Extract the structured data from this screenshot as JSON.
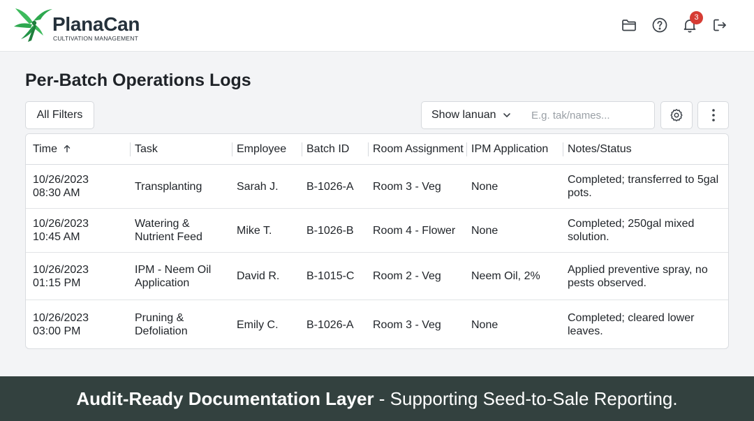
{
  "brand": {
    "name": "PlanaCan",
    "tagline": "CULTIVATION MANAGEMENT"
  },
  "header": {
    "notification_count": "3"
  },
  "page": {
    "title": "Per-Batch Operations Logs"
  },
  "toolbar": {
    "all_filters": "All Filters",
    "show_select": "Show lanuan",
    "search_placeholder": "E.g. tak/names..."
  },
  "table": {
    "columns": [
      "Time",
      "Task",
      "Employee",
      "Batch ID",
      "Room Assignment",
      "IPM Application",
      "Notes/Status"
    ],
    "rows": [
      {
        "date": "10/26/2023",
        "time": "08:30 AM",
        "task_1": "Transplanting",
        "task_2": "",
        "employee": "Sarah J.",
        "batch": "B-1026-A",
        "room": "Room 3 - Veg",
        "ipm": "None",
        "notes_1": "Completed; transferred to 5gal",
        "notes_2": "pots."
      },
      {
        "date": "10/26/2023",
        "time": "10:45 AM",
        "task_1": "Watering &",
        "task_2": "Nutrient Feed",
        "employee": "Mike T.",
        "batch": "B-1026-B",
        "room": "Room 4 - Flower",
        "ipm": "None",
        "notes_1": "Completed; 250gal mixed",
        "notes_2": "solution."
      },
      {
        "date": "10/26/2023",
        "time": "01:15 PM",
        "task_1": "IPM - Neem Oil",
        "task_2": "Application",
        "employee": "David R.",
        "batch": "B-1015-C",
        "room": "Room 2 - Veg",
        "ipm": "Neem Oil, 2%",
        "notes_1": "Applied preventive spray, no",
        "notes_2": "pests observed."
      },
      {
        "date": "10/26/2023",
        "time": "03:00 PM",
        "task_1": "Pruning &",
        "task_2": "Defoliation",
        "employee": "Emily C.",
        "batch": "B-1026-A",
        "room": "Room 3 - Veg",
        "ipm": "None",
        "notes_1": "Completed; cleared lower",
        "notes_2": "leaves."
      }
    ]
  },
  "footer": {
    "bold": "Audit-Ready Documentation Layer",
    "rest": " - Supporting Seed-to-Sale Reporting."
  },
  "icons": {
    "logo": "hummingbird-leaf-icon",
    "folder": "folder-icon",
    "help": "help-circle-icon",
    "bell": "bell-icon",
    "logout": "logout-icon",
    "chevron": "chevron-down-icon",
    "settings": "settings-icon",
    "more": "more-vertical-icon",
    "sort": "arrow-up-icon"
  },
  "colors": {
    "brand_green": "#2ea84f",
    "badge": "#d63c34",
    "footer_bg": "#33413f"
  }
}
